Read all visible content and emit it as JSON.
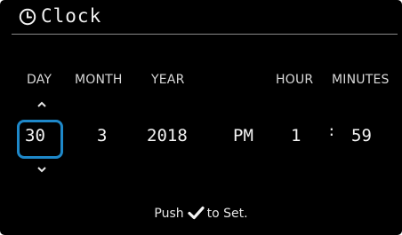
{
  "header": {
    "title": "Clock"
  },
  "labels": {
    "day": "DAY",
    "month": "MONTH",
    "year": "YEAR",
    "hour": "HOUR",
    "minutes": "MINUTES"
  },
  "values": {
    "day": "30",
    "month": "3",
    "year": "2018",
    "ampm": "PM",
    "hour": "1",
    "separator": ":",
    "minutes": "59"
  },
  "footer": {
    "prefix": "Push",
    "suffix": "to Set."
  },
  "colors": {
    "background": "#000000",
    "text": "#e6e6e6",
    "selection": "#1e88c9"
  },
  "icons": {
    "header": "clock-icon",
    "up": "chevron-up-icon",
    "down": "chevron-down-icon",
    "confirm": "check-icon"
  }
}
